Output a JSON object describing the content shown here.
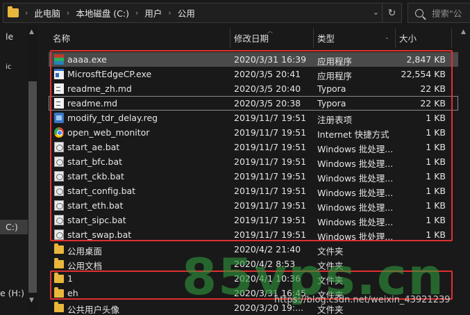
{
  "address": {
    "crumbs": [
      "此电脑",
      "本地磁盘 (C:)",
      "用户",
      "公用"
    ]
  },
  "search": {
    "placeholder": "搜索\"公"
  },
  "nav": {
    "items": [
      "le",
      "ic",
      "C:)",
      "e (H:)"
    ]
  },
  "columns": {
    "name": "名称",
    "date": "修改日期",
    "type": "类型",
    "size": "大小"
  },
  "files": [
    {
      "name": "aaaa.exe",
      "date": "2020/3/31 16:39",
      "type": "应用程序",
      "size": "2,847 KB",
      "icon": "exe-icon"
    },
    {
      "name": "MicrosftEdgeCP.exe",
      "date": "2020/3/5 20:41",
      "type": "应用程序",
      "size": "22,554 KB",
      "icon": "app-icon"
    },
    {
      "name": "readme_zh.md",
      "date": "2020/3/5 20:40",
      "type": "Typora",
      "size": "22 KB",
      "icon": "document-icon"
    },
    {
      "name": "readme.md",
      "date": "2020/3/5 20:38",
      "type": "Typora",
      "size": "22 KB",
      "icon": "document-icon"
    },
    {
      "name": "modify_tdr_delay.reg",
      "date": "2019/11/7 19:51",
      "type": "注册表项",
      "size": "1 KB",
      "icon": "registry-icon"
    },
    {
      "name": "open_web_monitor",
      "date": "2019/11/7 19:51",
      "type": "Internet 快捷方式",
      "size": "1 KB",
      "icon": "web-shortcut-icon"
    },
    {
      "name": "start_ae.bat",
      "date": "2019/11/7 19:51",
      "type": "Windows 批处理...",
      "size": "1 KB",
      "icon": "batch-file-icon"
    },
    {
      "name": "start_bfc.bat",
      "date": "2019/11/7 19:51",
      "type": "Windows 批处理...",
      "size": "1 KB",
      "icon": "batch-file-icon"
    },
    {
      "name": "start_ckb.bat",
      "date": "2019/11/7 19:51",
      "type": "Windows 批处理...",
      "size": "1 KB",
      "icon": "batch-file-icon"
    },
    {
      "name": "start_config.bat",
      "date": "2019/11/7 19:51",
      "type": "Windows 批处理...",
      "size": "1 KB",
      "icon": "batch-file-icon"
    },
    {
      "name": "start_eth.bat",
      "date": "2019/11/7 19:51",
      "type": "Windows 批处理...",
      "size": "1 KB",
      "icon": "batch-file-icon"
    },
    {
      "name": "start_sipc.bat",
      "date": "2019/11/7 19:51",
      "type": "Windows 批处理...",
      "size": "1 KB",
      "icon": "batch-file-icon"
    },
    {
      "name": "start_swap.bat",
      "date": "2019/11/7 19:51",
      "type": "Windows 批处理...",
      "size": "1 KB",
      "icon": "batch-file-icon"
    },
    {
      "name": "公用桌面",
      "date": "2020/4/2 21:40",
      "type": "文件夹",
      "size": "",
      "icon": "folder-icon"
    },
    {
      "name": "公用文档",
      "date": "2020/4/2 8:53",
      "type": "文件夹",
      "size": "",
      "icon": "folder-icon"
    },
    {
      "name": "1",
      "date": "2020/4/1 10:36",
      "type": "文件夹",
      "size": "",
      "icon": "folder-icon"
    },
    {
      "name": "eh",
      "date": "2020/3/31 16:45",
      "type": "文件夹",
      "size": "",
      "icon": "folder-icon"
    },
    {
      "name": "公共用户头像",
      "date": "2020/3/20 19:...",
      "type": "文件夹",
      "size": "",
      "icon": "folder-icon"
    }
  ],
  "watermark": {
    "logo": "85vps.cn",
    "url": "https://blog.csdn.net/weixin_43921239"
  },
  "colors": {
    "background": "#191919",
    "highlight": "#e03030",
    "selected_row": "#4a4a4a",
    "folder": "#e8b73c"
  }
}
